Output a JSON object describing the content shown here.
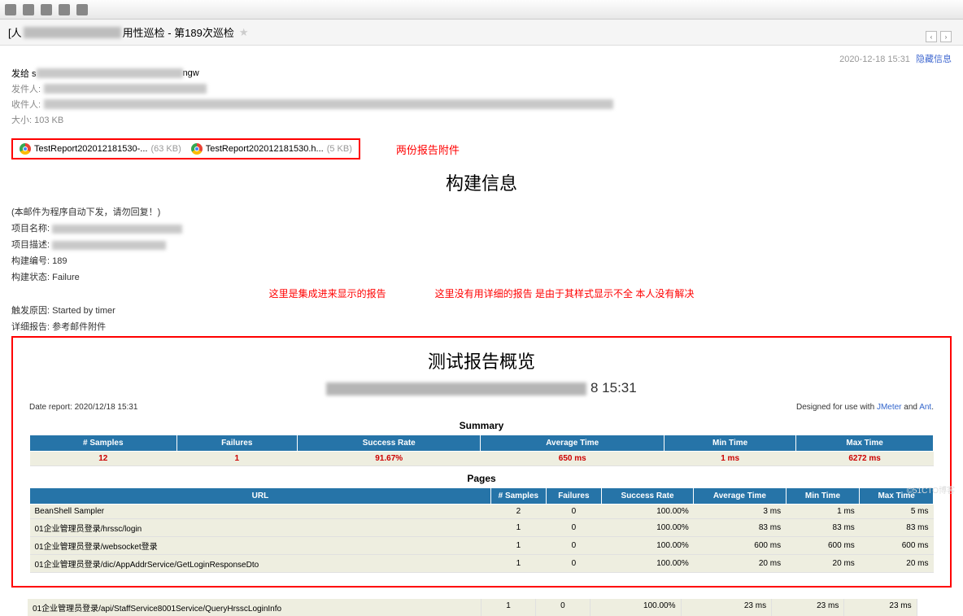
{
  "subject_prefix": "[人",
  "subject_suffix": "用性巡检 - 第189次巡检",
  "header": {
    "to_label": "发给 s",
    "to_suffix": "ngw",
    "sender_label": "发件人:",
    "recipient_label": "收件人:",
    "size_label": "大小: 103 KB",
    "timestamp": "2020-12-18 15:31",
    "hide_link": "隐藏信息"
  },
  "attachments": [
    {
      "name": "TestReport202012181530-...",
      "size": "(63 KB)"
    },
    {
      "name": "TestReport202012181530.h...",
      "size": "(5 KB)"
    }
  ],
  "annotations": {
    "attach": "两份报告附件",
    "mid_left": "这里是集成进来显示的报告",
    "mid_right": "这里没有用详细的报告 是由于其样式显示不全 本人没有解决"
  },
  "build": {
    "title": "构建信息",
    "note": "(本邮件为程序自动下发，请勿回复！)",
    "rows": {
      "project_name_label": "项目名称:",
      "project_desc_label": "项目描述:",
      "build_no_label": "构建编号:",
      "build_no": "189",
      "build_status_label": "构建状态:",
      "build_status": "Failure",
      "trigger_label": "触发原因:",
      "trigger": "Started by timer",
      "detail_label": "详细报告:",
      "detail": "参考邮件附件"
    }
  },
  "report": {
    "title": "测试报告概览",
    "subtitle_suffix": "8 15:31",
    "date_label": "Date report: 2020/12/18 15:31",
    "designed": "Designed for use with ",
    "link1": "JMeter",
    "and": " and ",
    "link2": "Ant",
    "summary_title": "Summary",
    "summary_headers": [
      "# Samples",
      "Failures",
      "Success Rate",
      "Average Time",
      "Min Time",
      "Max Time"
    ],
    "summary_row": [
      "12",
      "1",
      "91.67%",
      "650 ms",
      "1 ms",
      "6272 ms"
    ],
    "pages_title": "Pages",
    "pages_headers": [
      "URL",
      "# Samples",
      "Failures",
      "Success Rate",
      "Average Time",
      "Min Time",
      "Max Time"
    ],
    "pages_rows": [
      [
        "BeanShell Sampler",
        "2",
        "0",
        "100.00%",
        "3 ms",
        "1 ms",
        "5 ms"
      ],
      [
        "01企业管理员登录/hrssc/login",
        "1",
        "0",
        "100.00%",
        "83 ms",
        "83 ms",
        "83 ms"
      ],
      [
        "01企业管理员登录/websocket登录",
        "1",
        "0",
        "100.00%",
        "600 ms",
        "600 ms",
        "600 ms"
      ],
      [
        "01企业管理员登录/dic/AppAddrService/GetLoginResponseDto",
        "1",
        "0",
        "100.00%",
        "20 ms",
        "20 ms",
        "20 ms"
      ]
    ],
    "outside_row": [
      "01企业管理员登录/api/StaffService8001Service/QueryHrsscLoginInfo",
      "1",
      "0",
      "100.00%",
      "23 ms",
      "23 ms",
      "23 ms"
    ]
  },
  "watermark": "©51CTO博客"
}
